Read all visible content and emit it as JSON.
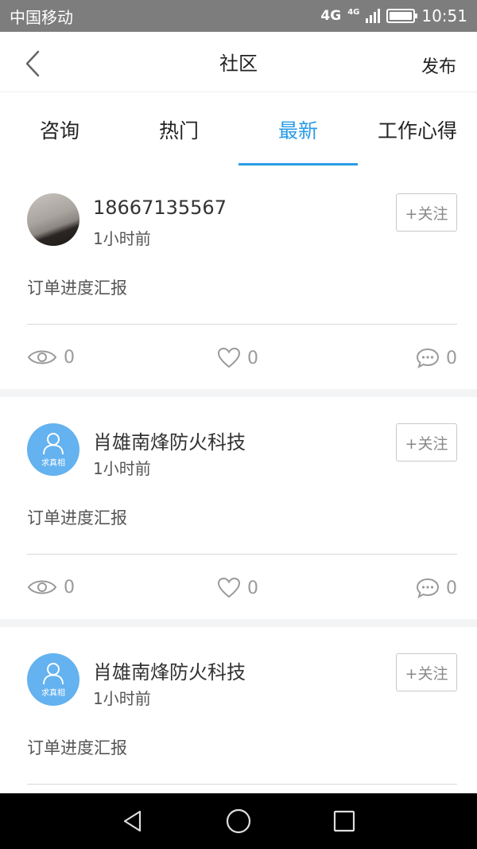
{
  "status_bar": {
    "carrier": "中国移动",
    "network": "4G",
    "network_small": "4G",
    "time": "10:51"
  },
  "header": {
    "title": "社区",
    "publish_label": "发布"
  },
  "tabs": [
    {
      "label": "咨询"
    },
    {
      "label": "热门"
    },
    {
      "label": "最新",
      "active": true
    },
    {
      "label": "工作心得"
    }
  ],
  "posts": [
    {
      "author": "18667135567",
      "time": "1小时前",
      "content": "订单进度汇报",
      "follow_label": "+关注",
      "views": "0",
      "likes": "0",
      "comments": "0",
      "avatar": "photo"
    },
    {
      "author": "肖雄南烽防火科技",
      "time": "1小时前",
      "content": "订单进度汇报",
      "follow_label": "+关注",
      "views": "0",
      "likes": "0",
      "comments": "0",
      "avatar": "default",
      "avatar_label": "求真相"
    },
    {
      "author": "肖雄南烽防火科技",
      "time": "1小时前",
      "content": "订单进度汇报",
      "follow_label": "+关注",
      "avatar": "default",
      "avatar_label": "求真相"
    }
  ],
  "colors": {
    "accent": "#2b9be8",
    "avatar_default": "#64b2ef",
    "status_bar": "#7d7d7d"
  },
  "icons": [
    "back-arrow-icon",
    "eye-icon",
    "heart-icon",
    "comment-icon",
    "user-icon",
    "battery-icon",
    "signal-icon",
    "back-triangle-icon",
    "home-circle-icon",
    "recents-square-icon"
  ]
}
